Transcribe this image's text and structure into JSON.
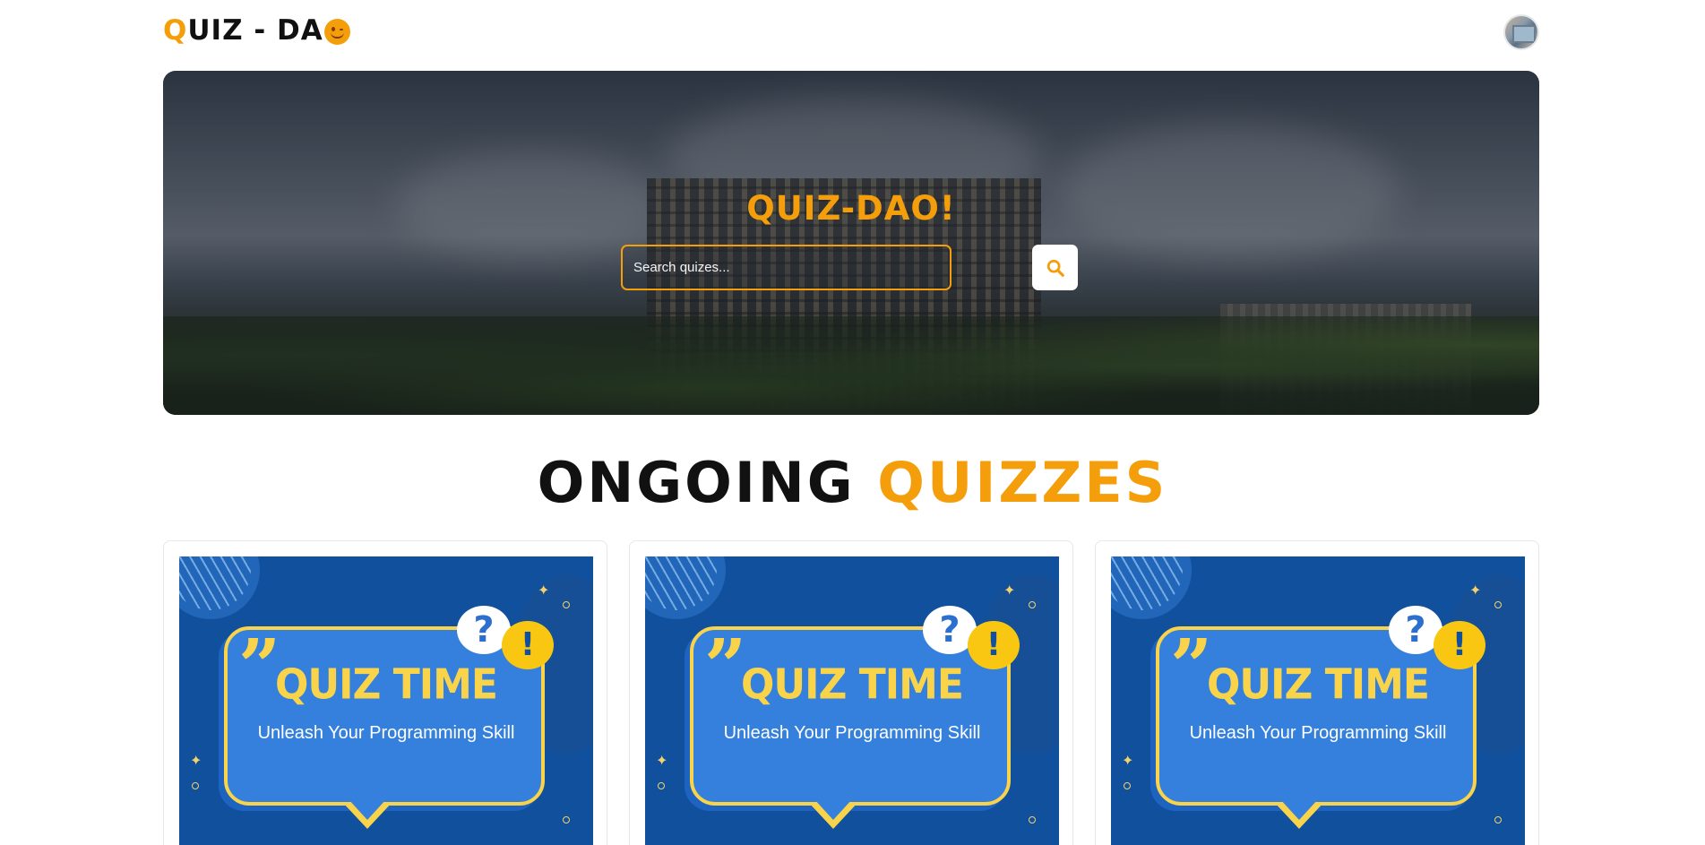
{
  "header": {
    "logo_q": "Q",
    "logo_rest": "UIZ - DA",
    "logo_emoji_icon": "smiling-face-icon"
  },
  "hero": {
    "title": "QUIZ-DAO!",
    "search_placeholder": "Search quizes...",
    "search_icon": "search-icon"
  },
  "section": {
    "title_word1": "ONGOING",
    "title_word2": "QUIZZES"
  },
  "quizzes": [
    {
      "banner_title": "QUIZ TIME",
      "banner_subtitle": "Unleash Your Programming Skill",
      "question_glyph": "?",
      "exclaim_glyph": "!"
    },
    {
      "banner_title": "QUIZ TIME",
      "banner_subtitle": "Unleash Your Programming Skill",
      "question_glyph": "?",
      "exclaim_glyph": "!"
    },
    {
      "banner_title": "QUIZ TIME",
      "banner_subtitle": "Unleash Your Programming Skill",
      "question_glyph": "?",
      "exclaim_glyph": "!"
    }
  ],
  "colors": {
    "accent": "#f59e0b",
    "banner_bg": "#10509c",
    "banner_yellow": "#f9d44a"
  }
}
